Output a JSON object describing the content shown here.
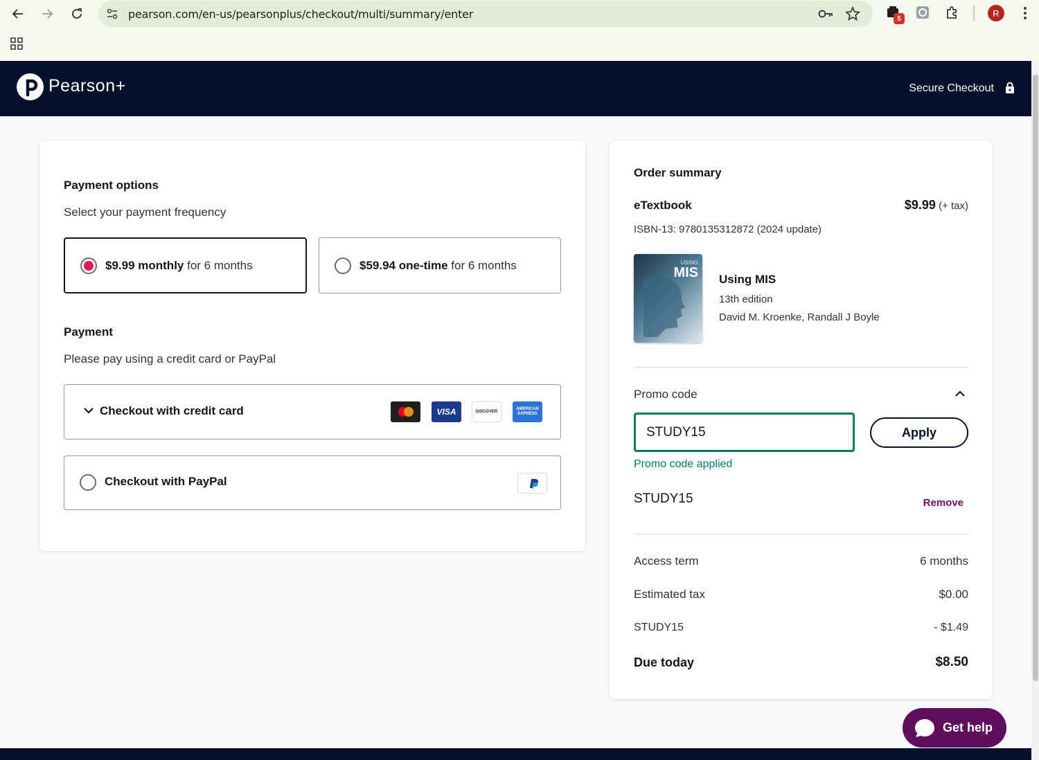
{
  "browser": {
    "url": "pearson.com/en-us/pearsonplus/checkout/multi/summary/enter",
    "extension_badge": "5",
    "profile_initial": "R"
  },
  "header": {
    "logo_text": "Pearson+",
    "secure_label": "Secure Checkout"
  },
  "payment_options": {
    "heading": "Payment options",
    "subtitle": "Select your payment frequency",
    "options": [
      {
        "price": "$9.99 monthly",
        "term": " for 6 months",
        "selected": true
      },
      {
        "price": "$59.94 one-time",
        "term": " for 6 months",
        "selected": false
      }
    ]
  },
  "payment": {
    "heading": "Payment",
    "subtitle": "Please pay using a credit card or PayPal",
    "credit_card_label": "Checkout with credit card",
    "paypal_label": "Checkout with PayPal",
    "card_logos": [
      "mastercard-icon",
      "visa-icon",
      "discover-icon",
      "amex-icon"
    ],
    "visa_text": "VISA",
    "discover_text": "DISCOVER",
    "amex_text": "AMERICAN EXPRESS"
  },
  "order_summary": {
    "heading": "Order summary",
    "product_type": "eTextbook",
    "price": "$9.99",
    "price_note": "(+ tax)",
    "isbn": "ISBN-13: 9780135312872 (2024 update)",
    "book_title": "Using MIS",
    "book_cover_small": "USING",
    "book_cover_big": "MIS",
    "edition": "13th edition",
    "authors": "David M. Kroenke, Randall J Boyle"
  },
  "promo": {
    "label": "Promo code",
    "input_value": "STUDY15",
    "apply_label": "Apply",
    "status": "Promo code applied",
    "applied_code": "STUDY15",
    "remove_label": "Remove"
  },
  "totals": [
    {
      "label": "Access term",
      "value": "6 months"
    },
    {
      "label": "Estimated tax",
      "value": "$0.00"
    },
    {
      "label": "STUDY15",
      "value": "- $1.49"
    }
  ],
  "due": {
    "label": "Due today",
    "value": "$8.50"
  },
  "help": {
    "label": "Get help"
  },
  "colors": {
    "navy": "#05112a",
    "accent_pink": "#e8175d",
    "promo_green": "#007a62",
    "remove_purple": "#6c0f6b",
    "help_purple": "#5f0e5c"
  }
}
